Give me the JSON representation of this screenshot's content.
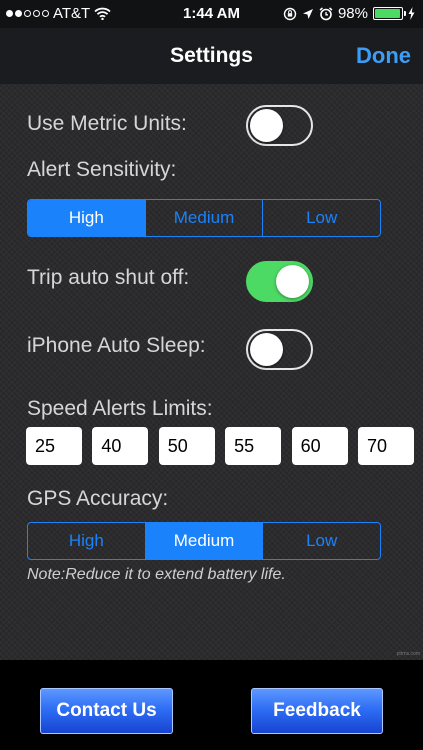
{
  "status_bar": {
    "carrier": "AT&T",
    "time": "1:44 AM",
    "battery_percent": "98%",
    "battery_level": 0.98,
    "signal_bars_full": 2,
    "signal_bars_total": 5,
    "icons": [
      "wifi-icon",
      "rotation-lock-icon",
      "location-arrow-icon",
      "alarm-icon",
      "battery-icon",
      "charging-bolt-icon"
    ]
  },
  "nav": {
    "title": "Settings",
    "done_label": "Done"
  },
  "settings": {
    "metric_units": {
      "label": "Use Metric Units:",
      "on": false
    },
    "alert_sensitivity": {
      "label": "Alert Sensitivity:",
      "options": [
        "High",
        "Medium",
        "Low"
      ],
      "selected": "High"
    },
    "trip_auto_shut_off": {
      "label": "Trip auto shut off:",
      "on": true
    },
    "iphone_auto_sleep": {
      "label": "iPhone Auto Sleep:",
      "on": false
    },
    "speed_alerts": {
      "label": "Speed Alerts Limits:",
      "values": [
        "25",
        "40",
        "50",
        "55",
        "60",
        "70"
      ]
    },
    "gps_accuracy": {
      "label": "GPS Accuracy:",
      "options": [
        "High",
        "Medium",
        "Low"
      ],
      "selected": "Medium",
      "note": "Note:Reduce it to extend battery life."
    }
  },
  "footer": {
    "contact_label": "Contact Us",
    "feedback_label": "Feedback"
  },
  "watermark": "pttrns.com",
  "colors": {
    "accent": "#1a82fb",
    "nav_done": "#3d9df6",
    "toggle_on": "#4cd964",
    "button_blue": "#2f6ef5"
  }
}
